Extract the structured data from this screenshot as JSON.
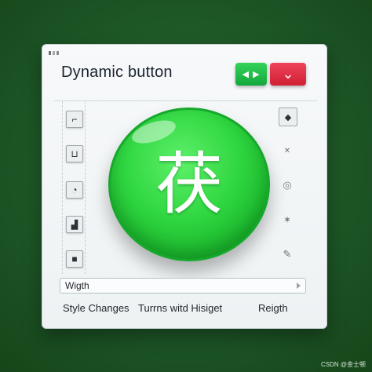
{
  "window": {
    "title": "Dynamic button"
  },
  "toggles": {
    "green_glyph": "◀ ▶",
    "red_glyph": "⌄"
  },
  "main_button": {
    "glyph": "茯"
  },
  "left_icons": [
    {
      "name": "corner-frame-icon",
      "glyph": "⌐"
    },
    {
      "name": "bracket-icon",
      "glyph": "⊔"
    },
    {
      "name": "rounded-corner-icon",
      "glyph": "◔"
    },
    {
      "name": "corner-mark-icon",
      "glyph": "▟"
    },
    {
      "name": "square-icon",
      "glyph": "■"
    }
  ],
  "right_icons": [
    {
      "name": "diamond-icon",
      "glyph": "◆",
      "boxed": true
    },
    {
      "name": "cross-icon",
      "glyph": "✕",
      "boxed": false
    },
    {
      "name": "swirl-icon",
      "glyph": "◎",
      "boxed": false
    },
    {
      "name": "cursor-spark-icon",
      "glyph": "✶",
      "boxed": false
    },
    {
      "name": "pencil-icon",
      "glyph": "✎",
      "boxed": false
    }
  ],
  "input": {
    "value": "Wigth"
  },
  "footer": {
    "style_changes": "Style Changes",
    "turns_with": "Turrns witd Hisiget",
    "reigth": "Reigth"
  },
  "watermark": "CSDN @金士顿"
}
